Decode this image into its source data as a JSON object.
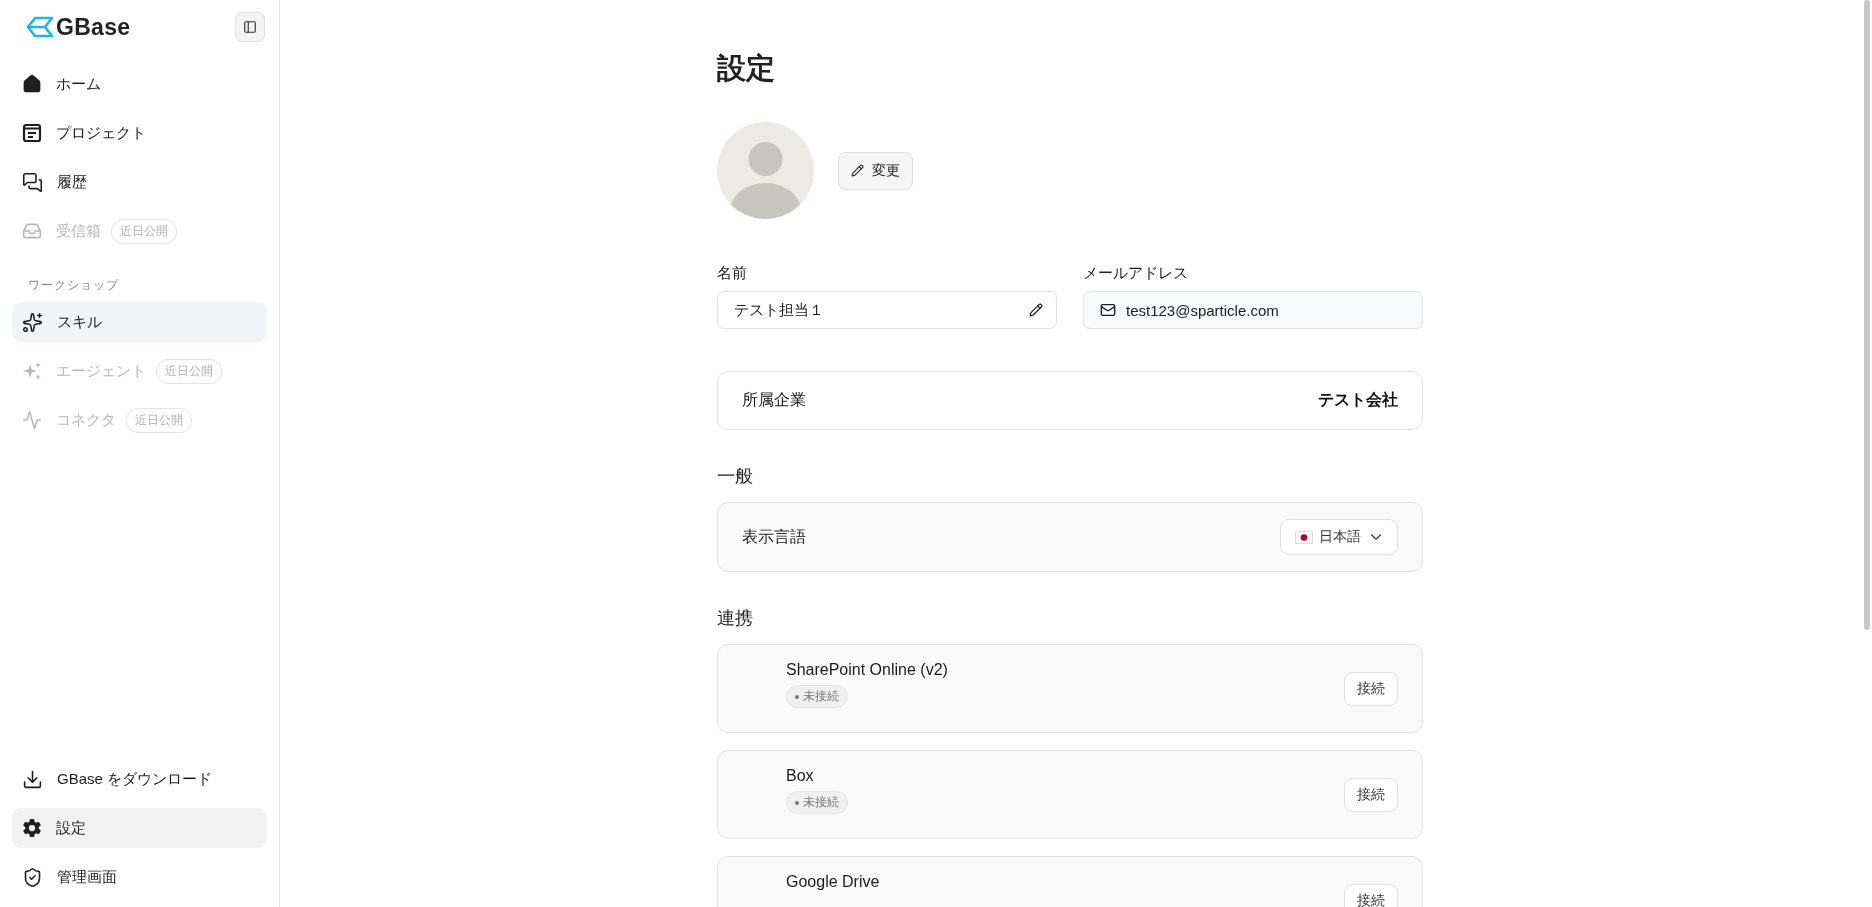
{
  "sidebar": {
    "logo": "GBase",
    "items": [
      {
        "kind": "home",
        "label": "ホーム",
        "disabled": false,
        "selected": false
      },
      {
        "kind": "project",
        "label": "プロジェクト",
        "disabled": false,
        "selected": false
      },
      {
        "kind": "history",
        "label": "履歴",
        "disabled": false,
        "selected": false
      },
      {
        "kind": "inbox",
        "label": "受信箱",
        "disabled": true,
        "selected": false,
        "badge": "近日公開"
      }
    ],
    "section_title": "ワークショップ",
    "workshop_items": [
      {
        "kind": "sparkles",
        "label": "スキル",
        "disabled": false,
        "selected": true
      },
      {
        "kind": "agent",
        "label": "エージェント",
        "disabled": true,
        "selected": false,
        "badge": "近日公開"
      },
      {
        "kind": "connector",
        "label": "コネクタ",
        "disabled": true,
        "selected": false,
        "badge": "近日公開"
      }
    ],
    "bottom_items": [
      {
        "kind": "download",
        "label": "GBase をダウンロード",
        "disabled": false,
        "selected": false
      },
      {
        "kind": "settings",
        "label": "設定",
        "disabled": false,
        "selected": true
      },
      {
        "kind": "shield",
        "label": "管理画面",
        "disabled": false,
        "selected": false
      }
    ]
  },
  "page": {
    "title": "設定",
    "change_button": "変更",
    "name": {
      "label": "名前",
      "value": "テスト担当１"
    },
    "email": {
      "label": "メールアドレス",
      "value": "test123@sparticle.com"
    },
    "company": {
      "label": "所属企業",
      "value": "テスト会社"
    },
    "general": {
      "title": "一般",
      "language": {
        "label": "表示言語",
        "value": "日本語"
      }
    },
    "integrations": {
      "title": "連携",
      "items": [
        {
          "name": "SharePoint Online (v2)",
          "connected": false,
          "status": "未接続",
          "button": "接続"
        },
        {
          "name": "Box",
          "connected": false,
          "status": "未接続",
          "button": "接続"
        },
        {
          "name": "Google Drive",
          "button": "接続"
        }
      ]
    }
  }
}
